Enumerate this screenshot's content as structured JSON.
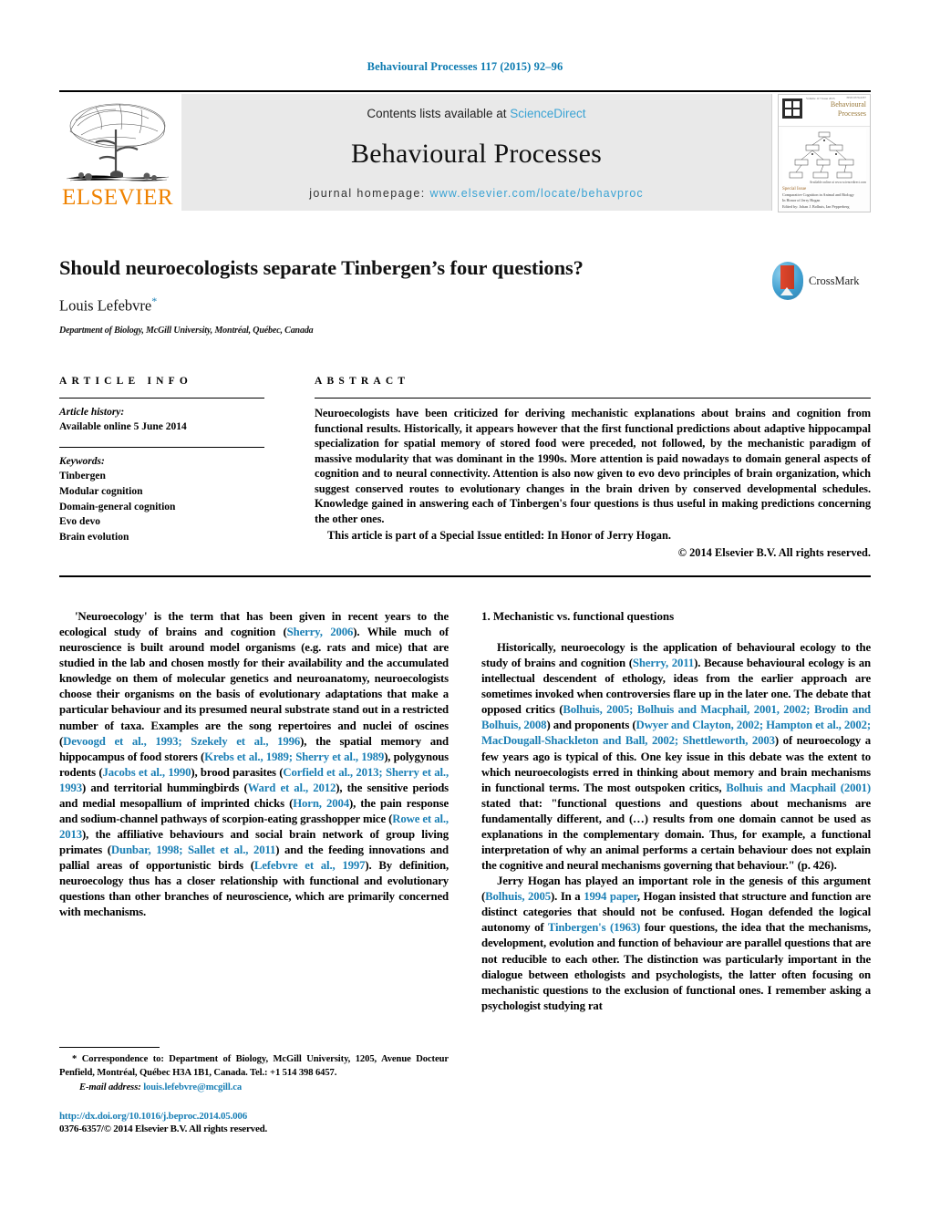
{
  "running_head": "Behavioural Processes 117 (2015) 92–96",
  "masthead": {
    "publisher_name": "ELSEVIER",
    "contents_prefix": "Contents lists available at",
    "contents_link": "ScienceDirect",
    "journal_name": "Behavioural Processes",
    "homepage_prefix": "journal homepage:",
    "homepage_url": "www.elsevier.com/locate/behavproc",
    "cover": {
      "title_line1": "Behavioural",
      "title_line2": "Processes",
      "meta_left": "ISSN 0376-6357",
      "meta_volume": "Volume 117  Issue 2015",
      "footer_line1": "Special Issue",
      "footer_line2": "Comparative Cognition in Animal and Biology",
      "footer_line3": "In Honor of Jerry Hogan",
      "footer_line4": "Edited by: Johan J. Bolhuis, Ian Pepperberg",
      "footer_right": "Available online at www.sciencedirect.com"
    }
  },
  "article": {
    "title": "Should neuroecologists separate Tinbergen’s four questions?",
    "author": "Louis Lefebvre",
    "author_marker": "*",
    "affiliation": "Department of Biology, McGill University, Montréal, Québec, Canada",
    "crossmark_label": "CrossMark"
  },
  "info": {
    "heading": "ARTICLE INFO",
    "history_label": "Article history:",
    "history_value": "Available online 5 June 2014",
    "keywords_label": "Keywords:",
    "keywords": [
      "Tinbergen",
      "Modular cognition",
      "Domain-general cognition",
      "Evo devo",
      "Brain evolution"
    ]
  },
  "abstract": {
    "heading": "ABSTRACT",
    "body": "Neuroecologists have been criticized for deriving mechanistic explanations about brains and cognition from functional results. Historically, it appears however that the first functional predictions about adaptive hippocampal specialization for spatial memory of stored food were preceded, not followed, by the mechanistic paradigm of massive modularity that was dominant in the 1990s. More attention is paid nowadays to domain general aspects of cognition and to neural connectivity. Attention is also now given to evo devo principles of brain organization, which suggest conserved routes to evolutionary changes in the brain driven by conserved developmental schedules. Knowledge gained in answering each of Tinbergen's four questions is thus useful in making predictions concerning the other ones.",
    "special_issue": "This article is part of a Special Issue entitled: In Honor of Jerry Hogan.",
    "copyright": "© 2014 Elsevier B.V. All rights reserved."
  },
  "body": {
    "left_paragraphs": [
      {
        "runs": [
          {
            "t": "'Neuroecology' is the term that has been given in recent years to the ecological study of brains and cognition ("
          },
          {
            "t": "Sherry, 2006",
            "link": true
          },
          {
            "t": "). While much of neuroscience is built around model organisms (e.g. rats and mice) that are studied in the lab and chosen mostly for their availability and the accumulated knowledge on them of molecular genetics and neuroanatomy, neuroecologists choose their organisms on the basis of evolutionary adaptations that make a particular behaviour and its presumed neural substrate stand out in a restricted number of taxa. Examples are the song repertoires and nuclei of oscines ("
          },
          {
            "t": "Devoogd et al., 1993; Szekely et al., 1996",
            "link": true
          },
          {
            "t": "), the spatial memory and hippocampus of food storers ("
          },
          {
            "t": "Krebs et al., 1989; Sherry et al., 1989",
            "link": true
          },
          {
            "t": "), polygynous rodents ("
          },
          {
            "t": "Jacobs et al., 1990",
            "link": true
          },
          {
            "t": "), brood parasites ("
          },
          {
            "t": "Corfield et al., 2013; Sherry et al., 1993",
            "link": true
          },
          {
            "t": ") and territorial hummingbirds ("
          },
          {
            "t": "Ward et al., 2012",
            "link": true
          },
          {
            "t": "), the sensitive periods and medial mesopallium of imprinted chicks ("
          },
          {
            "t": "Horn, 2004",
            "link": true
          },
          {
            "t": "), the pain response and sodium-channel pathways of scorpion-eating grasshopper mice ("
          },
          {
            "t": "Rowe et al., 2013",
            "link": true
          },
          {
            "t": "), the affiliative behaviours and social brain network of group living primates ("
          },
          {
            "t": "Dunbar, 1998; Sallet et al., 2011",
            "link": true
          },
          {
            "t": ") and the feeding innovations and pallial areas of opportunistic birds ("
          },
          {
            "t": "Lefebvre et al., 1997",
            "link": true
          },
          {
            "t": "). By definition, neuroecology thus has a closer relationship with functional and evolutionary questions than other branches of neuroscience, which are primarily concerned with mechanisms."
          }
        ]
      }
    ],
    "right_section_title": "1. Mechanistic vs. functional questions",
    "right_paragraphs": [
      {
        "runs": [
          {
            "t": "Historically, neuroecology is the application of behavioural ecology to the study of brains and cognition ("
          },
          {
            "t": "Sherry, 2011",
            "link": true
          },
          {
            "t": "). Because behavioural ecology is an intellectual descendent of ethology, ideas from the earlier approach are sometimes invoked when controversies flare up in the later one. The debate that opposed critics ("
          },
          {
            "t": "Bolhuis, 2005; Bolhuis and Macphail, 2001, 2002; Brodin and Bolhuis, 2008",
            "link": true
          },
          {
            "t": ") and proponents ("
          },
          {
            "t": "Dwyer and Clayton, 2002; Hampton et al., 2002; MacDougall-Shackleton and Ball, 2002; Shettleworth, 2003",
            "link": true
          },
          {
            "t": ") of neuroecology a few years ago is typical of this. One key issue in this debate was the extent to which neuroecologists erred in thinking about memory and brain mechanisms in functional terms. The most outspoken critics, "
          },
          {
            "t": "Bolhuis and Macphail (2001)",
            "link": true
          },
          {
            "t": " stated that: \"functional questions and questions about mechanisms are fundamentally different, and (…) results from one domain cannot be used as explanations in the complementary domain. Thus, for example, a functional interpretation of why an animal performs a certain behaviour does not explain the cognitive and neural mechanisms governing that behaviour.\" (p. 426)."
          }
        ]
      },
      {
        "runs": [
          {
            "t": "Jerry Hogan has played an important role in the genesis of this argument ("
          },
          {
            "t": "Bolhuis, 2005",
            "link": true
          },
          {
            "t": "). In a "
          },
          {
            "t": "1994 paper",
            "link": true
          },
          {
            "t": ", Hogan insisted that structure and function are distinct categories that should not be confused. Hogan defended the logical autonomy of "
          },
          {
            "t": "Tinbergen's (1963)",
            "link": true
          },
          {
            "t": " four questions, the idea that the mechanisms, development, evolution and function of behaviour are parallel questions that are not reducible to each other. The distinction was particularly important in the dialogue between ethologists and psychologists, the latter often focusing on mechanistic questions to the exclusion of functional ones. I remember asking a psychologist studying rat"
          }
        ]
      }
    ]
  },
  "footer": {
    "correspondence_marker": "*",
    "correspondence": "Correspondence to: Department of Biology, McGill University, 1205, Avenue Docteur Penfield, Montréal, Québec H3A 1B1, Canada. Tel.: +1 514 398 6457.",
    "email_label": "E-mail address:",
    "email": "louis.lefebvre@mcgill.ca",
    "doi": "http://dx.doi.org/10.1016/j.beproc.2014.05.006",
    "issn_line": "0376-6357/© 2014 Elsevier B.V. All rights reserved."
  },
  "colors": {
    "link": "#1a7fb5",
    "elsevier_orange": "#ef8200",
    "sciencedirect": "#3aa3d4"
  }
}
